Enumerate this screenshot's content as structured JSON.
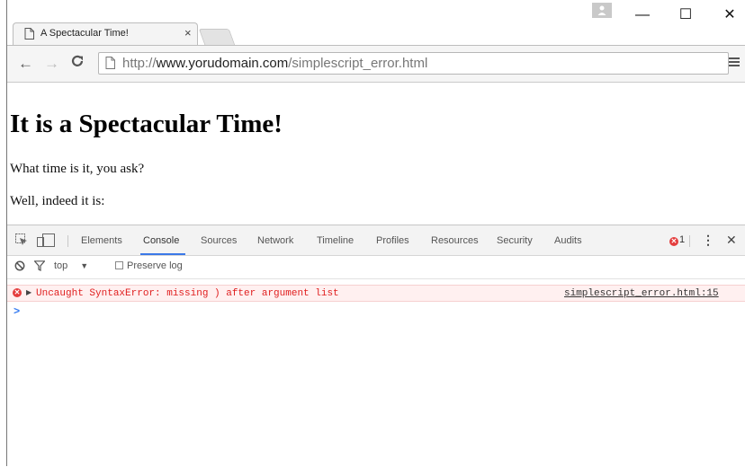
{
  "browser": {
    "tab": {
      "title": "A Spectacular Time!",
      "close_label": "×"
    },
    "window_controls": {
      "minimize": "—",
      "maximize": "☐",
      "close": "✕"
    },
    "icons": [
      "page-icon",
      "back-icon",
      "forward-icon",
      "reload-icon",
      "menu-icon",
      "profile-icon"
    ],
    "url": {
      "scheme": "http://",
      "host": "www.yorudomain.com",
      "path": "/simplescript_error.html"
    }
  },
  "page": {
    "heading": "It is a Spectacular Time!",
    "para1": "What time is it, you ask?",
    "para2": "Well, indeed it is:"
  },
  "devtools": {
    "tabs": [
      "Elements",
      "Console",
      "Sources",
      "Network",
      "Timeline",
      "Profiles",
      "Resources",
      "Security",
      "Audits"
    ],
    "active_tab": "Console",
    "error_count": "1",
    "filter": {
      "context": "top",
      "preserve_log": "Preserve log"
    },
    "console": {
      "error_message": "Uncaught SyntaxError: missing ) after argument list",
      "error_source": "simplescript_error.html:15",
      "prompt": ">"
    },
    "colors": {
      "error": "#e02020",
      "accent": "#3b78e7",
      "prompt": "#367cf1"
    }
  }
}
